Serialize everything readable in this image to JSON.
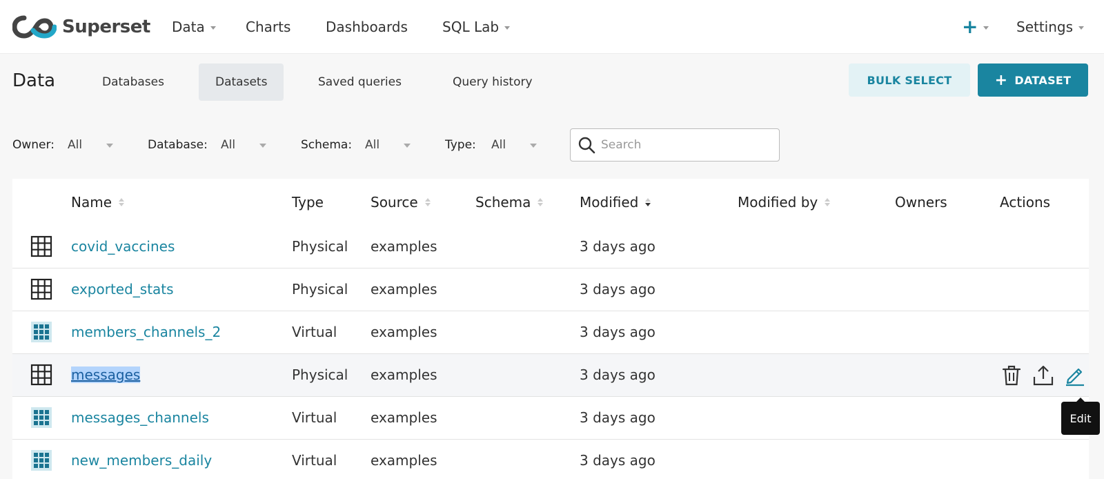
{
  "app": {
    "logo_text": "Superset",
    "logo_icon": "infinity-logo-icon",
    "brand_color": "#1a85a0"
  },
  "topnav": {
    "items": [
      {
        "label": "Data",
        "dropdown": true
      },
      {
        "label": "Charts",
        "dropdown": false
      },
      {
        "label": "Dashboards",
        "dropdown": false
      },
      {
        "label": "SQL Lab",
        "dropdown": true
      }
    ],
    "plus_label": "+",
    "settings_label": "Settings"
  },
  "subheader": {
    "title": "Data",
    "tabs": [
      {
        "label": "Databases",
        "active": false
      },
      {
        "label": "Datasets",
        "active": true
      },
      {
        "label": "Saved queries",
        "active": false
      },
      {
        "label": "Query history",
        "active": false
      }
    ],
    "bulk_select_label": "BULK SELECT",
    "add_dataset_label": "DATASET",
    "add_dataset_icon": "+"
  },
  "filters": {
    "owner": {
      "label": "Owner:",
      "value": "All"
    },
    "database": {
      "label": "Database:",
      "value": "All"
    },
    "schema": {
      "label": "Schema:",
      "value": "All"
    },
    "type": {
      "label": "Type:",
      "value": "All"
    },
    "search": {
      "placeholder": "Search",
      "value": ""
    }
  },
  "table": {
    "headers": {
      "name": "Name",
      "type": "Type",
      "source": "Source",
      "schema": "Schema",
      "modified": "Modified",
      "modified_by": "Modified by",
      "owners": "Owners",
      "actions": "Actions"
    },
    "rows": [
      {
        "kind": "physical",
        "name": "covid_vaccines",
        "type": "Physical",
        "source": "examples",
        "schema": "",
        "modified": "3 days ago"
      },
      {
        "kind": "physical",
        "name": "exported_stats",
        "type": "Physical",
        "source": "examples",
        "schema": "",
        "modified": "3 days ago"
      },
      {
        "kind": "virtual",
        "name": "members_channels_2",
        "type": "Virtual",
        "source": "examples",
        "schema": "",
        "modified": "3 days ago"
      },
      {
        "kind": "physical",
        "name": "messages",
        "type": "Physical",
        "source": "examples",
        "schema": "",
        "modified": "3 days ago"
      },
      {
        "kind": "virtual",
        "name": "messages_channels",
        "type": "Virtual",
        "source": "examples",
        "schema": "",
        "modified": "3 days ago"
      },
      {
        "kind": "virtual",
        "name": "new_members_daily",
        "type": "Virtual",
        "source": "examples",
        "schema": "",
        "modified": "3 days ago"
      }
    ]
  },
  "tooltip": {
    "label": "Edit"
  }
}
